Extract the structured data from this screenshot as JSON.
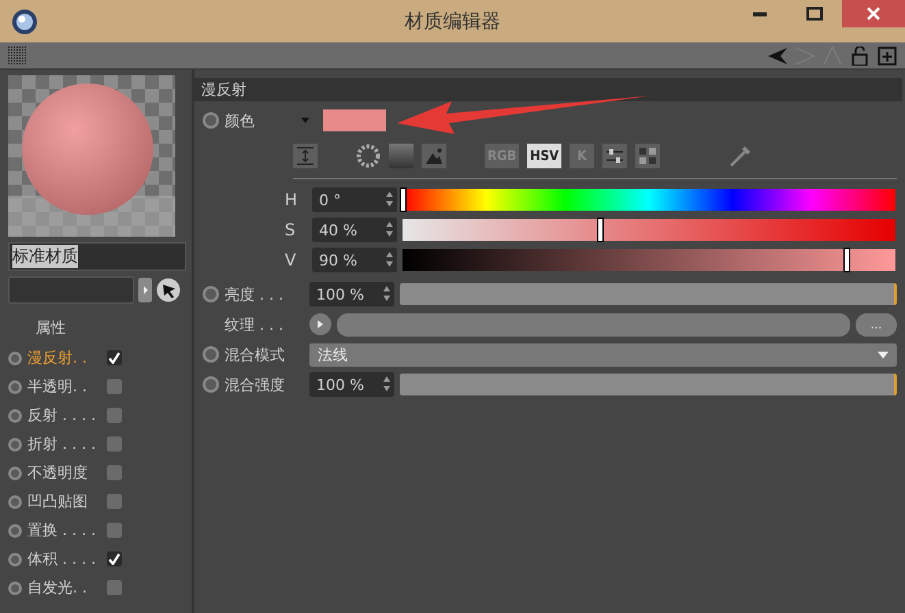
{
  "window": {
    "title": "材质编辑器"
  },
  "material_name": "标准材质",
  "properties_heading": "属性",
  "channels": [
    {
      "label": "漫反射. .",
      "selected": true,
      "checked": true
    },
    {
      "label": "半透明. .",
      "selected": false,
      "checked": false
    },
    {
      "label": "反射 . . . .",
      "selected": false,
      "checked": false
    },
    {
      "label": "折射 . . . .",
      "selected": false,
      "checked": false
    },
    {
      "label": "不透明度",
      "selected": false,
      "checked": false
    },
    {
      "label": "凹凸贴图",
      "selected": false,
      "checked": false
    },
    {
      "label": "置换 . . . .",
      "selected": false,
      "checked": false
    },
    {
      "label": "体积 . . . .",
      "selected": false,
      "checked": true
    },
    {
      "label": "自发光. .",
      "selected": false,
      "checked": false
    }
  ],
  "section": {
    "title": "漫反射"
  },
  "color": {
    "label": "颜色",
    "modes": [
      {
        "label": "RGB",
        "selected": false
      },
      {
        "label": "HSV",
        "selected": true
      },
      {
        "label": "K",
        "selected": false
      }
    ],
    "sliders": [
      {
        "kind": "hue",
        "label": "H",
        "value": "0 °",
        "level": 0
      },
      {
        "kind": "saturation",
        "label": "S",
        "value": "40 %",
        "level": 0.4
      },
      {
        "kind": "value",
        "label": "V",
        "value": "90 %",
        "level": 0.9
      }
    ]
  },
  "brightness": {
    "label": "亮度 . . .",
    "value": "100 %",
    "level": 1
  },
  "texture": {
    "label": "纹理 . . .",
    "button": "..."
  },
  "blend_mode": {
    "label": "混合模式",
    "value": "法线"
  },
  "blend_strength": {
    "label": "混合强度",
    "value": "100 %",
    "level": 1
  }
}
